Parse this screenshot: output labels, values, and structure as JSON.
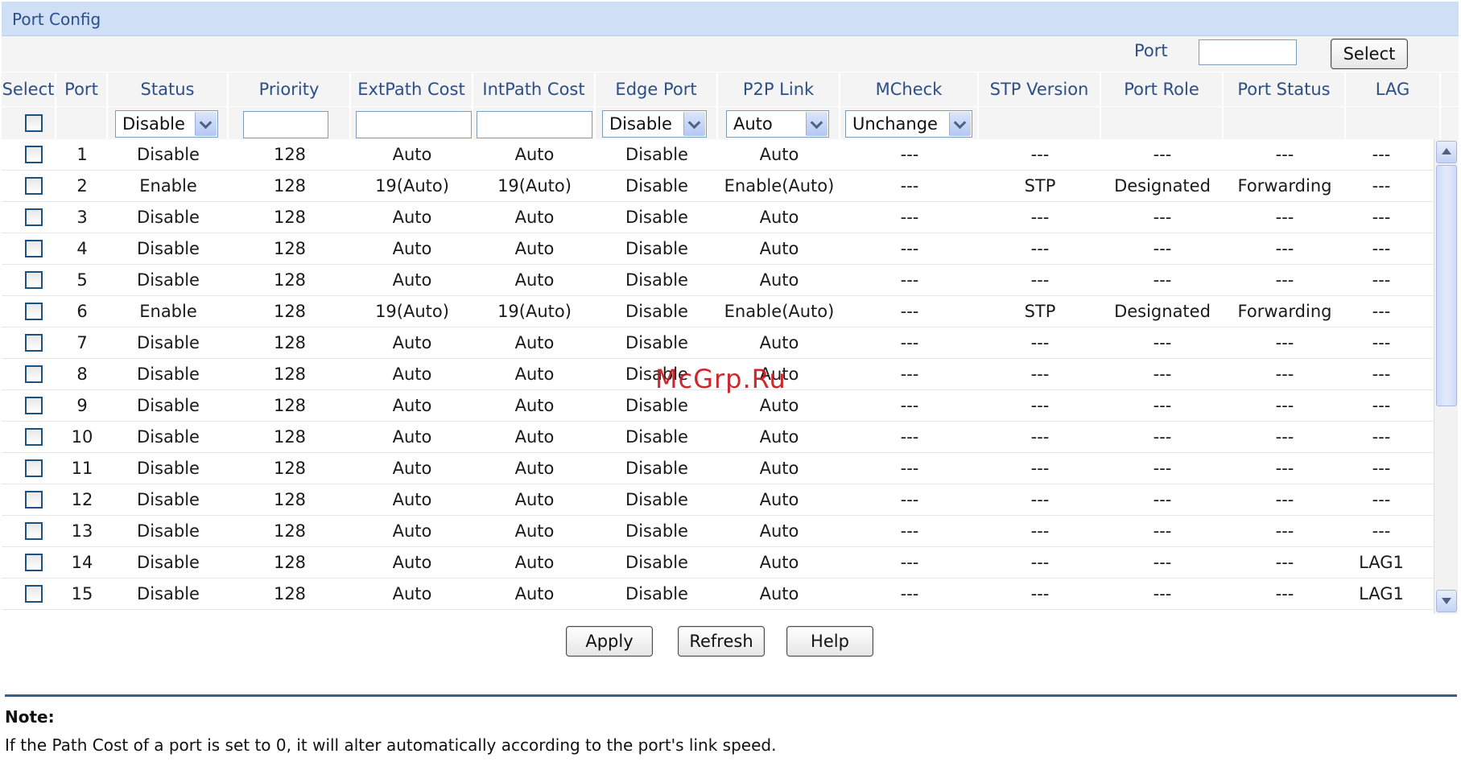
{
  "panel": {
    "title": "Port Config"
  },
  "port_search": {
    "label": "Port",
    "value": "",
    "button": "Select"
  },
  "columns": [
    "Select",
    "Port",
    "Status",
    "Priority",
    "ExtPath Cost",
    "IntPath Cost",
    "Edge Port",
    "P2P Link",
    "MCheck",
    "STP Version",
    "Port Role",
    "Port Status",
    "LAG"
  ],
  "controls": {
    "status": "Disable",
    "priority": "",
    "ext_path_cost": "",
    "int_path_cost": "",
    "edge_port": "Disable",
    "p2p_link": "Auto",
    "mcheck": "Unchange"
  },
  "rows": [
    {
      "port": "1",
      "status": "Disable",
      "priority": "128",
      "ext": "Auto",
      "int": "Auto",
      "edge": "Disable",
      "p2p": "Auto",
      "mcheck": "---",
      "stp": "---",
      "role": "---",
      "pstatus": "---",
      "lag": "---"
    },
    {
      "port": "2",
      "status": "Enable",
      "priority": "128",
      "ext": "19(Auto)",
      "int": "19(Auto)",
      "edge": "Disable",
      "p2p": "Enable(Auto)",
      "mcheck": "---",
      "stp": "STP",
      "role": "Designated",
      "pstatus": "Forwarding",
      "lag": "---"
    },
    {
      "port": "3",
      "status": "Disable",
      "priority": "128",
      "ext": "Auto",
      "int": "Auto",
      "edge": "Disable",
      "p2p": "Auto",
      "mcheck": "---",
      "stp": "---",
      "role": "---",
      "pstatus": "---",
      "lag": "---"
    },
    {
      "port": "4",
      "status": "Disable",
      "priority": "128",
      "ext": "Auto",
      "int": "Auto",
      "edge": "Disable",
      "p2p": "Auto",
      "mcheck": "---",
      "stp": "---",
      "role": "---",
      "pstatus": "---",
      "lag": "---"
    },
    {
      "port": "5",
      "status": "Disable",
      "priority": "128",
      "ext": "Auto",
      "int": "Auto",
      "edge": "Disable",
      "p2p": "Auto",
      "mcheck": "---",
      "stp": "---",
      "role": "---",
      "pstatus": "---",
      "lag": "---"
    },
    {
      "port": "6",
      "status": "Enable",
      "priority": "128",
      "ext": "19(Auto)",
      "int": "19(Auto)",
      "edge": "Disable",
      "p2p": "Enable(Auto)",
      "mcheck": "---",
      "stp": "STP",
      "role": "Designated",
      "pstatus": "Forwarding",
      "lag": "---"
    },
    {
      "port": "7",
      "status": "Disable",
      "priority": "128",
      "ext": "Auto",
      "int": "Auto",
      "edge": "Disable",
      "p2p": "Auto",
      "mcheck": "---",
      "stp": "---",
      "role": "---",
      "pstatus": "---",
      "lag": "---"
    },
    {
      "port": "8",
      "status": "Disable",
      "priority": "128",
      "ext": "Auto",
      "int": "Auto",
      "edge": "Disable",
      "p2p": "Auto",
      "mcheck": "---",
      "stp": "---",
      "role": "---",
      "pstatus": "---",
      "lag": "---"
    },
    {
      "port": "9",
      "status": "Disable",
      "priority": "128",
      "ext": "Auto",
      "int": "Auto",
      "edge": "Disable",
      "p2p": "Auto",
      "mcheck": "---",
      "stp": "---",
      "role": "---",
      "pstatus": "---",
      "lag": "---"
    },
    {
      "port": "10",
      "status": "Disable",
      "priority": "128",
      "ext": "Auto",
      "int": "Auto",
      "edge": "Disable",
      "p2p": "Auto",
      "mcheck": "---",
      "stp": "---",
      "role": "---",
      "pstatus": "---",
      "lag": "---"
    },
    {
      "port": "11",
      "status": "Disable",
      "priority": "128",
      "ext": "Auto",
      "int": "Auto",
      "edge": "Disable",
      "p2p": "Auto",
      "mcheck": "---",
      "stp": "---",
      "role": "---",
      "pstatus": "---",
      "lag": "---"
    },
    {
      "port": "12",
      "status": "Disable",
      "priority": "128",
      "ext": "Auto",
      "int": "Auto",
      "edge": "Disable",
      "p2p": "Auto",
      "mcheck": "---",
      "stp": "---",
      "role": "---",
      "pstatus": "---",
      "lag": "---"
    },
    {
      "port": "13",
      "status": "Disable",
      "priority": "128",
      "ext": "Auto",
      "int": "Auto",
      "edge": "Disable",
      "p2p": "Auto",
      "mcheck": "---",
      "stp": "---",
      "role": "---",
      "pstatus": "---",
      "lag": "---"
    },
    {
      "port": "14",
      "status": "Disable",
      "priority": "128",
      "ext": "Auto",
      "int": "Auto",
      "edge": "Disable",
      "p2p": "Auto",
      "mcheck": "---",
      "stp": "---",
      "role": "---",
      "pstatus": "---",
      "lag": "LAG1"
    },
    {
      "port": "15",
      "status": "Disable",
      "priority": "128",
      "ext": "Auto",
      "int": "Auto",
      "edge": "Disable",
      "p2p": "Auto",
      "mcheck": "---",
      "stp": "---",
      "role": "---",
      "pstatus": "---",
      "lag": "LAG1"
    }
  ],
  "buttons": {
    "apply": "Apply",
    "refresh": "Refresh",
    "help": "Help"
  },
  "note": {
    "title": "Note:",
    "text": "If the Path Cost of a port is set to 0, it will alter automatically according to the port's link speed."
  },
  "watermark": "McGrp.Ru",
  "colors": {
    "header_bg": "#cfe0f6",
    "header_text": "#2b4f86",
    "divider": "#35608f",
    "watermark": "#c8161d"
  }
}
